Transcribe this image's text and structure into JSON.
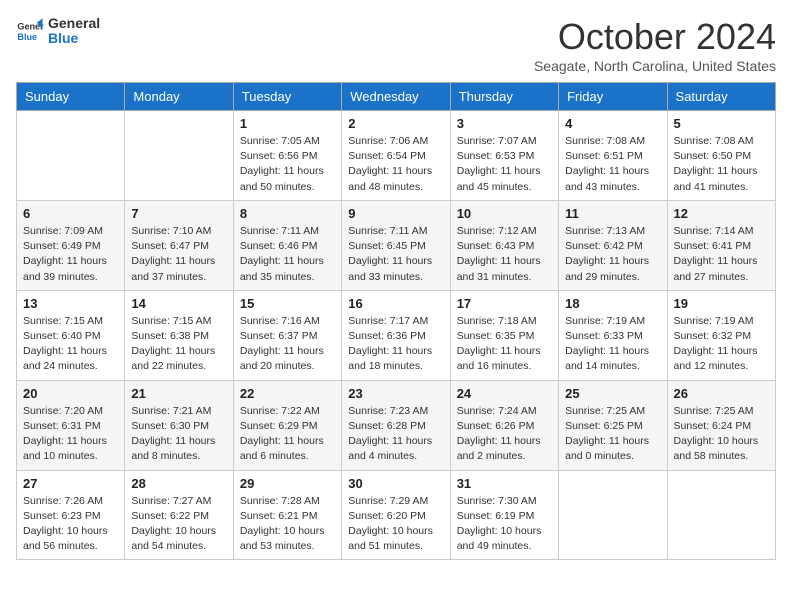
{
  "logo": {
    "line1": "General",
    "line2": "Blue"
  },
  "title": "October 2024",
  "location": "Seagate, North Carolina, United States",
  "days_of_week": [
    "Sunday",
    "Monday",
    "Tuesday",
    "Wednesday",
    "Thursday",
    "Friday",
    "Saturday"
  ],
  "weeks": [
    [
      {
        "day": "",
        "info": ""
      },
      {
        "day": "",
        "info": ""
      },
      {
        "day": "1",
        "info": "Sunrise: 7:05 AM\nSunset: 6:56 PM\nDaylight: 11 hours and 50 minutes."
      },
      {
        "day": "2",
        "info": "Sunrise: 7:06 AM\nSunset: 6:54 PM\nDaylight: 11 hours and 48 minutes."
      },
      {
        "day": "3",
        "info": "Sunrise: 7:07 AM\nSunset: 6:53 PM\nDaylight: 11 hours and 45 minutes."
      },
      {
        "day": "4",
        "info": "Sunrise: 7:08 AM\nSunset: 6:51 PM\nDaylight: 11 hours and 43 minutes."
      },
      {
        "day": "5",
        "info": "Sunrise: 7:08 AM\nSunset: 6:50 PM\nDaylight: 11 hours and 41 minutes."
      }
    ],
    [
      {
        "day": "6",
        "info": "Sunrise: 7:09 AM\nSunset: 6:49 PM\nDaylight: 11 hours and 39 minutes."
      },
      {
        "day": "7",
        "info": "Sunrise: 7:10 AM\nSunset: 6:47 PM\nDaylight: 11 hours and 37 minutes."
      },
      {
        "day": "8",
        "info": "Sunrise: 7:11 AM\nSunset: 6:46 PM\nDaylight: 11 hours and 35 minutes."
      },
      {
        "day": "9",
        "info": "Sunrise: 7:11 AM\nSunset: 6:45 PM\nDaylight: 11 hours and 33 minutes."
      },
      {
        "day": "10",
        "info": "Sunrise: 7:12 AM\nSunset: 6:43 PM\nDaylight: 11 hours and 31 minutes."
      },
      {
        "day": "11",
        "info": "Sunrise: 7:13 AM\nSunset: 6:42 PM\nDaylight: 11 hours and 29 minutes."
      },
      {
        "day": "12",
        "info": "Sunrise: 7:14 AM\nSunset: 6:41 PM\nDaylight: 11 hours and 27 minutes."
      }
    ],
    [
      {
        "day": "13",
        "info": "Sunrise: 7:15 AM\nSunset: 6:40 PM\nDaylight: 11 hours and 24 minutes."
      },
      {
        "day": "14",
        "info": "Sunrise: 7:15 AM\nSunset: 6:38 PM\nDaylight: 11 hours and 22 minutes."
      },
      {
        "day": "15",
        "info": "Sunrise: 7:16 AM\nSunset: 6:37 PM\nDaylight: 11 hours and 20 minutes."
      },
      {
        "day": "16",
        "info": "Sunrise: 7:17 AM\nSunset: 6:36 PM\nDaylight: 11 hours and 18 minutes."
      },
      {
        "day": "17",
        "info": "Sunrise: 7:18 AM\nSunset: 6:35 PM\nDaylight: 11 hours and 16 minutes."
      },
      {
        "day": "18",
        "info": "Sunrise: 7:19 AM\nSunset: 6:33 PM\nDaylight: 11 hours and 14 minutes."
      },
      {
        "day": "19",
        "info": "Sunrise: 7:19 AM\nSunset: 6:32 PM\nDaylight: 11 hours and 12 minutes."
      }
    ],
    [
      {
        "day": "20",
        "info": "Sunrise: 7:20 AM\nSunset: 6:31 PM\nDaylight: 11 hours and 10 minutes."
      },
      {
        "day": "21",
        "info": "Sunrise: 7:21 AM\nSunset: 6:30 PM\nDaylight: 11 hours and 8 minutes."
      },
      {
        "day": "22",
        "info": "Sunrise: 7:22 AM\nSunset: 6:29 PM\nDaylight: 11 hours and 6 minutes."
      },
      {
        "day": "23",
        "info": "Sunrise: 7:23 AM\nSunset: 6:28 PM\nDaylight: 11 hours and 4 minutes."
      },
      {
        "day": "24",
        "info": "Sunrise: 7:24 AM\nSunset: 6:26 PM\nDaylight: 11 hours and 2 minutes."
      },
      {
        "day": "25",
        "info": "Sunrise: 7:25 AM\nSunset: 6:25 PM\nDaylight: 11 hours and 0 minutes."
      },
      {
        "day": "26",
        "info": "Sunrise: 7:25 AM\nSunset: 6:24 PM\nDaylight: 10 hours and 58 minutes."
      }
    ],
    [
      {
        "day": "27",
        "info": "Sunrise: 7:26 AM\nSunset: 6:23 PM\nDaylight: 10 hours and 56 minutes."
      },
      {
        "day": "28",
        "info": "Sunrise: 7:27 AM\nSunset: 6:22 PM\nDaylight: 10 hours and 54 minutes."
      },
      {
        "day": "29",
        "info": "Sunrise: 7:28 AM\nSunset: 6:21 PM\nDaylight: 10 hours and 53 minutes."
      },
      {
        "day": "30",
        "info": "Sunrise: 7:29 AM\nSunset: 6:20 PM\nDaylight: 10 hours and 51 minutes."
      },
      {
        "day": "31",
        "info": "Sunrise: 7:30 AM\nSunset: 6:19 PM\nDaylight: 10 hours and 49 minutes."
      },
      {
        "day": "",
        "info": ""
      },
      {
        "day": "",
        "info": ""
      }
    ]
  ]
}
